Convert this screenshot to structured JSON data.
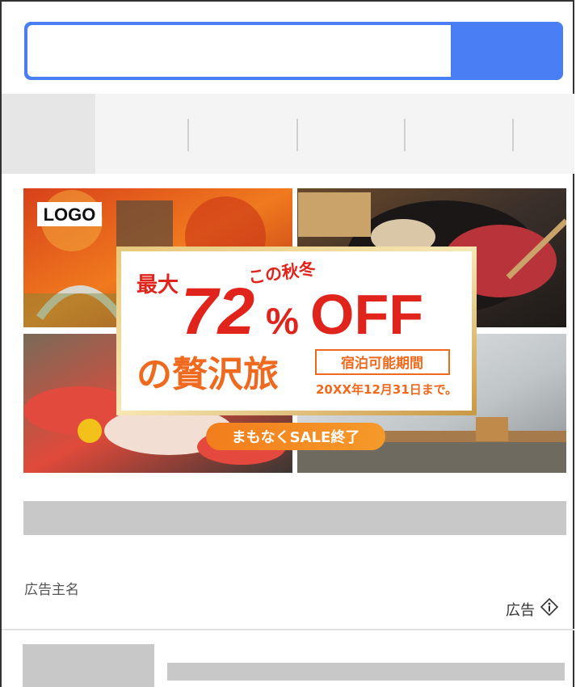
{
  "search": {
    "placeholder": ""
  },
  "tabs": [
    {
      "label": ""
    },
    {
      "label": ""
    },
    {
      "label": ""
    },
    {
      "label": ""
    },
    {
      "label": ""
    }
  ],
  "ad": {
    "logo": "LOGO",
    "season": "この秋冬",
    "headline_prefix": "最大",
    "discount": "72",
    "percent": "%",
    "off": "OFF",
    "subline": "の贅沢旅",
    "period_label": "宿泊可能期間",
    "period_date": "20XX年12月31日まで。",
    "sale_badge": "まもなくSALE終了",
    "advertiser": "広告主名",
    "ad_label": "広告"
  },
  "colors": {
    "accent_blue": "#4a7ef5",
    "banner_red": "#e0241c",
    "banner_orange": "#ef6a1e",
    "placeholder_gray": "#c8c8c8"
  }
}
